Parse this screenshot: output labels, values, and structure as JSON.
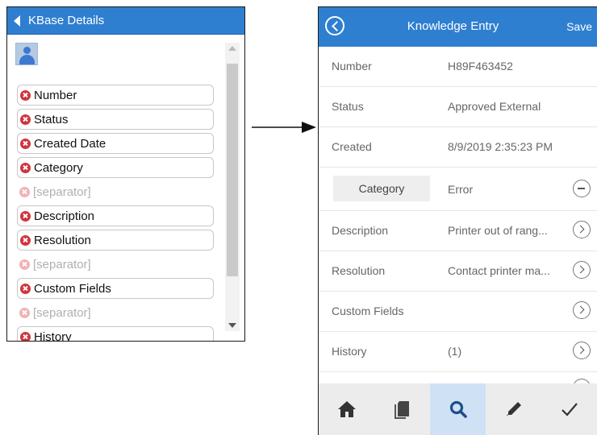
{
  "left_panel": {
    "header_title": "KBase Details",
    "items": [
      {
        "label": "Number",
        "separator": false
      },
      {
        "label": "Status",
        "separator": false
      },
      {
        "label": "Created Date",
        "separator": false
      },
      {
        "label": "Category",
        "separator": false
      },
      {
        "label": "[separator]",
        "separator": true
      },
      {
        "label": "Description",
        "separator": false
      },
      {
        "label": "Resolution",
        "separator": false
      },
      {
        "label": "[separator]",
        "separator": true
      },
      {
        "label": "Custom Fields",
        "separator": false
      },
      {
        "label": "[separator]",
        "separator": true
      },
      {
        "label": "History",
        "separator": false
      }
    ]
  },
  "right_panel": {
    "header_title": "Knowledge Entry",
    "save_label": "Save",
    "rows": [
      {
        "label": "Number",
        "value": "H89F463452",
        "action": "none"
      },
      {
        "label": "Status",
        "value": "Approved External",
        "action": "none"
      },
      {
        "label": "Created",
        "value": "8/9/2019 2:35:23 PM",
        "action": "none"
      },
      {
        "label": "Category",
        "value": "Error",
        "action": "more"
      },
      {
        "label": "Description",
        "value": "Printer out of rang...",
        "action": "go"
      },
      {
        "label": "Resolution",
        "value": "Contact printer ma...",
        "action": "go"
      },
      {
        "label": "Custom Fields",
        "value": "",
        "action": "go"
      },
      {
        "label": "History",
        "value": "(1)",
        "action": "go"
      }
    ],
    "toolbar": [
      {
        "icon": "home-icon",
        "active": false
      },
      {
        "icon": "pages-icon",
        "active": false
      },
      {
        "icon": "search-icon",
        "active": true
      },
      {
        "icon": "pencil-icon",
        "active": false
      },
      {
        "icon": "check-icon",
        "active": false
      }
    ]
  },
  "colors": {
    "header_blue": "#2f7fd1",
    "remove_red": "#d0363c",
    "toolbar_active": "#cfe1f4"
  }
}
